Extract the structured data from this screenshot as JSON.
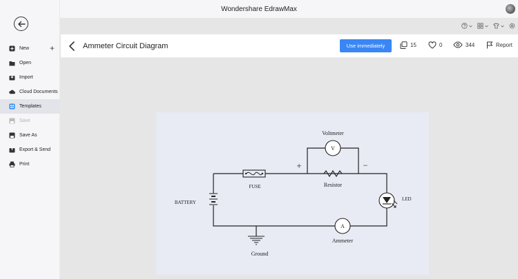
{
  "app": {
    "title": "Wondershare EdrawMax"
  },
  "sidebar": {
    "items": [
      {
        "label": "New",
        "icon": "plus-square-icon"
      },
      {
        "label": "Open",
        "icon": "folder-icon"
      },
      {
        "label": "Import",
        "icon": "import-icon"
      },
      {
        "label": "Cloud Documents",
        "icon": "cloud-icon"
      },
      {
        "label": "Templates",
        "icon": "templates-icon"
      },
      {
        "label": "Save",
        "icon": "save-icon"
      },
      {
        "label": "Save As",
        "icon": "save-as-icon"
      },
      {
        "label": "Export & Send",
        "icon": "export-icon"
      },
      {
        "label": "Print",
        "icon": "print-icon"
      }
    ],
    "new_plus": "+"
  },
  "header": {
    "title": "Ammeter Circuit Diagram",
    "use_button": "Use immediately",
    "copies": "15",
    "likes": "0",
    "views": "344",
    "report": "Report"
  },
  "diagram": {
    "voltmeter": "Voltmeter",
    "voltmeter_symbol": "V",
    "plus": "+",
    "minus": "−",
    "fuse": "FUSE",
    "resistor": "Resistor",
    "battery": "BATTERY",
    "led": "LED",
    "ammeter": "Ammeter",
    "ammeter_symbol": "A",
    "ground": "Ground"
  },
  "colors": {
    "accent": "#3a86f5",
    "active_item": "#e2e4ea",
    "diagram_bg": "#e8eaf4"
  }
}
